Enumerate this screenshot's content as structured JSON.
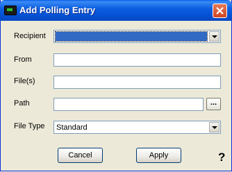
{
  "window": {
    "title": "Add Polling Entry"
  },
  "form": {
    "recipient_label": "Recipient",
    "recipient_value": "",
    "from_label": "From",
    "from_value": "",
    "files_label": "File(s)",
    "files_value": "",
    "path_label": "Path",
    "path_value": "",
    "browse_label": "...",
    "file_type_label": "File Type",
    "file_type_value": "Standard"
  },
  "buttons": {
    "cancel_label": "Cancel",
    "apply_label": "Apply",
    "help_label": "?"
  },
  "icons": {
    "title_icon": "modem-icon",
    "close_icon": "close-icon",
    "dropdown_icon": "chevron-down-icon"
  }
}
